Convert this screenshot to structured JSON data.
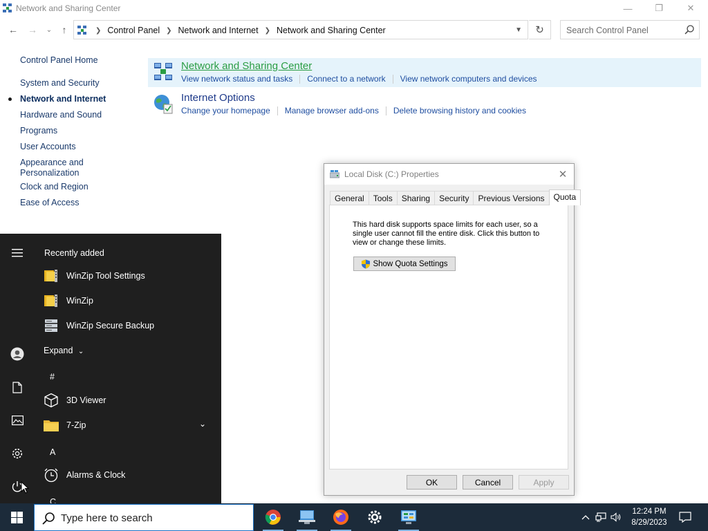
{
  "window": {
    "title": "Network and Sharing Center",
    "controls": {
      "minimize": "—",
      "maximize": "❐",
      "close": "✕"
    }
  },
  "navigation": {
    "back": "←",
    "forward": "→",
    "recent": "⌄",
    "up": "↑",
    "breadcrumb": [
      "Control Panel",
      "Network and Internet",
      "Network and Sharing Center"
    ],
    "refresh": "↻",
    "search_placeholder": "Search Control Panel"
  },
  "sidebar": {
    "home": "Control Panel Home",
    "items": [
      {
        "label": "System and Security",
        "active": false
      },
      {
        "label": "Network and Internet",
        "active": true
      },
      {
        "label": "Hardware and Sound",
        "active": false
      },
      {
        "label": "Programs",
        "active": false
      },
      {
        "label": "User Accounts",
        "active": false
      },
      {
        "label": "Appearance and\nPersonalization",
        "active": false
      },
      {
        "label": "Clock and Region",
        "active": false
      },
      {
        "label": "Ease of Access",
        "active": false
      }
    ]
  },
  "categories": [
    {
      "title": "Network and Sharing Center",
      "icon": "network-icon",
      "links": [
        "View network status and tasks",
        "Connect to a network",
        "View network computers and devices"
      ]
    },
    {
      "title": "Internet Options",
      "icon": "globe-icon",
      "links": [
        "Change your homepage",
        "Manage browser add-ons",
        "Delete browsing history and cookies"
      ]
    }
  ],
  "dialog": {
    "title": "Local Disk (C:) Properties",
    "close": "✕",
    "tabs": [
      "General",
      "Tools",
      "Sharing",
      "Security",
      "Previous Versions",
      "Quota"
    ],
    "active_tab": "Quota",
    "quota_text": "This hard disk supports space limits for each user, so a single user cannot fill the entire disk. Click this button to view or change these limits.",
    "quota_button": "Show Quota Settings",
    "buttons": {
      "ok": "OK",
      "cancel": "Cancel",
      "apply": "Apply"
    }
  },
  "start_menu": {
    "recently_added_label": "Recently added",
    "recent_apps": [
      "WinZip Tool Settings",
      "WinZip",
      "WinZip Secure Backup"
    ],
    "expand_label": "Expand",
    "sections": [
      {
        "letter": "#",
        "apps": [
          "3D Viewer",
          "7-Zip"
        ]
      },
      {
        "letter": "A",
        "apps": [
          "Alarms & Clock"
        ]
      },
      {
        "letter": "C",
        "apps": []
      }
    ]
  },
  "taskbar": {
    "search_placeholder": "Type here to search",
    "pinned_apps": [
      "chrome-icon",
      "file-explorer-icon",
      "firefox-icon",
      "settings-icon",
      "control-panel-icon"
    ],
    "clock_time": "12:24 PM",
    "clock_date": "8/29/2023"
  },
  "colors": {
    "taskbar": "#1c2b3a",
    "start_menu": "#1f1f1f",
    "link": "#1f4ea0",
    "highlight": "#e5f3fb",
    "category_hover_title": "#2a9d43"
  }
}
